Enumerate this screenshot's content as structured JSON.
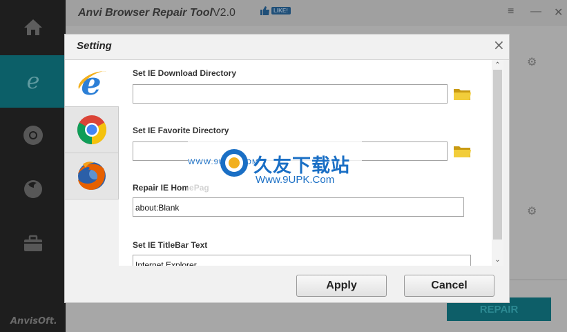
{
  "app": {
    "title": "Anvi Browser Repair Tool",
    "version": "V2.0",
    "like_label": "LIKE!",
    "brand": "AnvisOft.",
    "repair_label": "REPAIR",
    "sidebar_items": [
      {
        "name": "home",
        "icon": "home-icon"
      },
      {
        "name": "ie",
        "icon": "internet-explorer-icon",
        "active": true
      },
      {
        "name": "chrome",
        "icon": "chrome-icon"
      },
      {
        "name": "firefox",
        "icon": "firefox-icon"
      },
      {
        "name": "toolbox",
        "icon": "briefcase-icon"
      }
    ],
    "window_controls": [
      "menu-icon",
      "minimize-icon",
      "close-icon"
    ]
  },
  "dialog": {
    "title": "Setting",
    "close_glyph": "×",
    "tabs": [
      {
        "name": "internet-explorer",
        "icon": "internet-explorer-icon",
        "active": true
      },
      {
        "name": "chrome",
        "icon": "chrome-icon",
        "active": false
      },
      {
        "name": "firefox",
        "icon": "firefox-icon",
        "active": false
      }
    ],
    "fields": [
      {
        "label": "Set IE Download Directory",
        "value": "",
        "has_folder": true
      },
      {
        "label": "Set IE Favorite Directory",
        "value": "",
        "has_folder": true
      },
      {
        "label": "Repair IE HomePag",
        "value": "about:Blank",
        "has_folder": false
      },
      {
        "label": "Set IE TitleBar Text",
        "value": "Internet Explorer",
        "has_folder": false
      }
    ],
    "buttons": {
      "apply": "Apply",
      "cancel": "Cancel"
    }
  },
  "watermark": {
    "chinese": "久友下载站",
    "url": "Www.9UPK.Com",
    "left_text": "WWW.9UPK.COM"
  },
  "colors": {
    "accent_teal": "#0c5f68",
    "folder_yellow": "#e8c22b",
    "watermark_blue": "#1a6fc5"
  }
}
